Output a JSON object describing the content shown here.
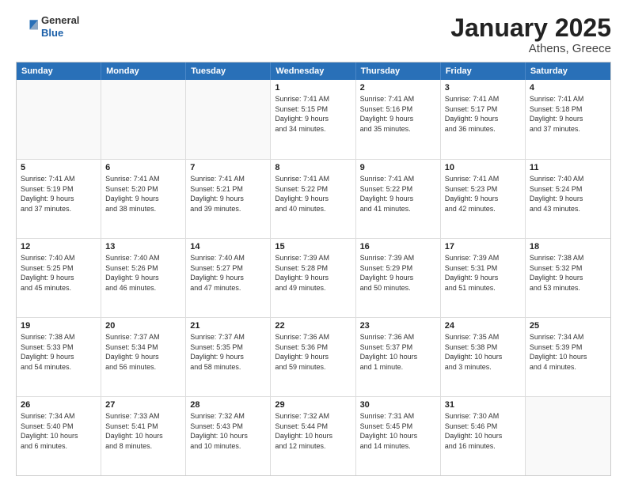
{
  "header": {
    "logo": {
      "general": "General",
      "blue": "Blue"
    },
    "title": "January 2025",
    "subtitle": "Athens, Greece"
  },
  "weekdays": [
    "Sunday",
    "Monday",
    "Tuesday",
    "Wednesday",
    "Thursday",
    "Friday",
    "Saturday"
  ],
  "weeks": [
    [
      {
        "day": "",
        "lines": []
      },
      {
        "day": "",
        "lines": []
      },
      {
        "day": "",
        "lines": []
      },
      {
        "day": "1",
        "lines": [
          "Sunrise: 7:41 AM",
          "Sunset: 5:15 PM",
          "Daylight: 9 hours",
          "and 34 minutes."
        ]
      },
      {
        "day": "2",
        "lines": [
          "Sunrise: 7:41 AM",
          "Sunset: 5:16 PM",
          "Daylight: 9 hours",
          "and 35 minutes."
        ]
      },
      {
        "day": "3",
        "lines": [
          "Sunrise: 7:41 AM",
          "Sunset: 5:17 PM",
          "Daylight: 9 hours",
          "and 36 minutes."
        ]
      },
      {
        "day": "4",
        "lines": [
          "Sunrise: 7:41 AM",
          "Sunset: 5:18 PM",
          "Daylight: 9 hours",
          "and 37 minutes."
        ]
      }
    ],
    [
      {
        "day": "5",
        "lines": [
          "Sunrise: 7:41 AM",
          "Sunset: 5:19 PM",
          "Daylight: 9 hours",
          "and 37 minutes."
        ]
      },
      {
        "day": "6",
        "lines": [
          "Sunrise: 7:41 AM",
          "Sunset: 5:20 PM",
          "Daylight: 9 hours",
          "and 38 minutes."
        ]
      },
      {
        "day": "7",
        "lines": [
          "Sunrise: 7:41 AM",
          "Sunset: 5:21 PM",
          "Daylight: 9 hours",
          "and 39 minutes."
        ]
      },
      {
        "day": "8",
        "lines": [
          "Sunrise: 7:41 AM",
          "Sunset: 5:22 PM",
          "Daylight: 9 hours",
          "and 40 minutes."
        ]
      },
      {
        "day": "9",
        "lines": [
          "Sunrise: 7:41 AM",
          "Sunset: 5:22 PM",
          "Daylight: 9 hours",
          "and 41 minutes."
        ]
      },
      {
        "day": "10",
        "lines": [
          "Sunrise: 7:41 AM",
          "Sunset: 5:23 PM",
          "Daylight: 9 hours",
          "and 42 minutes."
        ]
      },
      {
        "day": "11",
        "lines": [
          "Sunrise: 7:40 AM",
          "Sunset: 5:24 PM",
          "Daylight: 9 hours",
          "and 43 minutes."
        ]
      }
    ],
    [
      {
        "day": "12",
        "lines": [
          "Sunrise: 7:40 AM",
          "Sunset: 5:25 PM",
          "Daylight: 9 hours",
          "and 45 minutes."
        ]
      },
      {
        "day": "13",
        "lines": [
          "Sunrise: 7:40 AM",
          "Sunset: 5:26 PM",
          "Daylight: 9 hours",
          "and 46 minutes."
        ]
      },
      {
        "day": "14",
        "lines": [
          "Sunrise: 7:40 AM",
          "Sunset: 5:27 PM",
          "Daylight: 9 hours",
          "and 47 minutes."
        ]
      },
      {
        "day": "15",
        "lines": [
          "Sunrise: 7:39 AM",
          "Sunset: 5:28 PM",
          "Daylight: 9 hours",
          "and 49 minutes."
        ]
      },
      {
        "day": "16",
        "lines": [
          "Sunrise: 7:39 AM",
          "Sunset: 5:29 PM",
          "Daylight: 9 hours",
          "and 50 minutes."
        ]
      },
      {
        "day": "17",
        "lines": [
          "Sunrise: 7:39 AM",
          "Sunset: 5:31 PM",
          "Daylight: 9 hours",
          "and 51 minutes."
        ]
      },
      {
        "day": "18",
        "lines": [
          "Sunrise: 7:38 AM",
          "Sunset: 5:32 PM",
          "Daylight: 9 hours",
          "and 53 minutes."
        ]
      }
    ],
    [
      {
        "day": "19",
        "lines": [
          "Sunrise: 7:38 AM",
          "Sunset: 5:33 PM",
          "Daylight: 9 hours",
          "and 54 minutes."
        ]
      },
      {
        "day": "20",
        "lines": [
          "Sunrise: 7:37 AM",
          "Sunset: 5:34 PM",
          "Daylight: 9 hours",
          "and 56 minutes."
        ]
      },
      {
        "day": "21",
        "lines": [
          "Sunrise: 7:37 AM",
          "Sunset: 5:35 PM",
          "Daylight: 9 hours",
          "and 58 minutes."
        ]
      },
      {
        "day": "22",
        "lines": [
          "Sunrise: 7:36 AM",
          "Sunset: 5:36 PM",
          "Daylight: 9 hours",
          "and 59 minutes."
        ]
      },
      {
        "day": "23",
        "lines": [
          "Sunrise: 7:36 AM",
          "Sunset: 5:37 PM",
          "Daylight: 10 hours",
          "and 1 minute."
        ]
      },
      {
        "day": "24",
        "lines": [
          "Sunrise: 7:35 AM",
          "Sunset: 5:38 PM",
          "Daylight: 10 hours",
          "and 3 minutes."
        ]
      },
      {
        "day": "25",
        "lines": [
          "Sunrise: 7:34 AM",
          "Sunset: 5:39 PM",
          "Daylight: 10 hours",
          "and 4 minutes."
        ]
      }
    ],
    [
      {
        "day": "26",
        "lines": [
          "Sunrise: 7:34 AM",
          "Sunset: 5:40 PM",
          "Daylight: 10 hours",
          "and 6 minutes."
        ]
      },
      {
        "day": "27",
        "lines": [
          "Sunrise: 7:33 AM",
          "Sunset: 5:41 PM",
          "Daylight: 10 hours",
          "and 8 minutes."
        ]
      },
      {
        "day": "28",
        "lines": [
          "Sunrise: 7:32 AM",
          "Sunset: 5:43 PM",
          "Daylight: 10 hours",
          "and 10 minutes."
        ]
      },
      {
        "day": "29",
        "lines": [
          "Sunrise: 7:32 AM",
          "Sunset: 5:44 PM",
          "Daylight: 10 hours",
          "and 12 minutes."
        ]
      },
      {
        "day": "30",
        "lines": [
          "Sunrise: 7:31 AM",
          "Sunset: 5:45 PM",
          "Daylight: 10 hours",
          "and 14 minutes."
        ]
      },
      {
        "day": "31",
        "lines": [
          "Sunrise: 7:30 AM",
          "Sunset: 5:46 PM",
          "Daylight: 10 hours",
          "and 16 minutes."
        ]
      },
      {
        "day": "",
        "lines": []
      }
    ]
  ]
}
